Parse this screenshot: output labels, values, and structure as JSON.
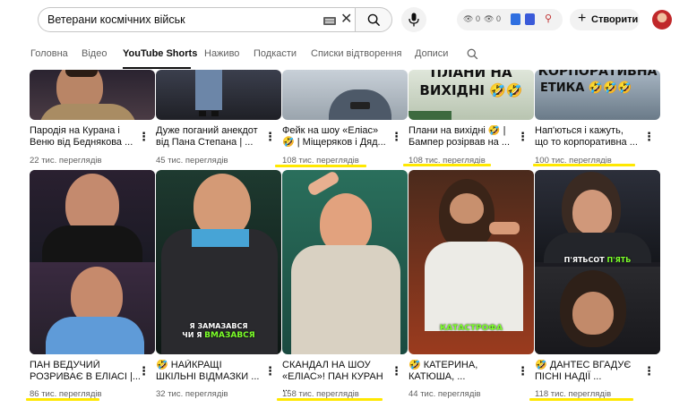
{
  "search": {
    "value": "Ветерани космічних військ"
  },
  "header": {
    "ext": {
      "count_a": "0",
      "count_b": "0"
    },
    "create_label": "Створити"
  },
  "tabs": [
    {
      "label": "Головна"
    },
    {
      "label": "Відео"
    },
    {
      "label": "YouTube Shorts"
    },
    {
      "label": "Наживо"
    },
    {
      "label": "Подкасти"
    },
    {
      "label": "Списки відтворення"
    },
    {
      "label": "Дописи"
    }
  ],
  "row1": [
    {
      "title_line1": "Пародія на Курана і",
      "title_line2": "Веню від Беднякова ...",
      "views": "22 тис. переглядів"
    },
    {
      "title_line1": "Дуже поганий анекдот",
      "title_line2": "від Пана Степана | ...",
      "views": "45 тис. переглядів"
    },
    {
      "title_line1": "Фейк на шоу «Еліас»",
      "title_line2": "🤣 | Міщеряков і Дяд...",
      "views": "108 тис. переглядів",
      "thumb_text": ""
    },
    {
      "title_line1": "Плани на вихідні 🤣 |",
      "title_line2": "Бампер розірвав на ...",
      "views": "108 тис. переглядів",
      "thumb_text_1": "ПЛАНИ НА",
      "thumb_text_2": "ВИХІДНІ 🤣🤣"
    },
    {
      "title_line1": "Нап'ються і кажуть,",
      "title_line2": "що то корпоративна ...",
      "views": "100 тис. переглядів",
      "thumb_text_1": "КОРПОРАТИВНА",
      "thumb_text_2": "ЕТИКА 🤣🤣🤣"
    }
  ],
  "row2": [
    {
      "title_line1": "ПАН ВЕДУЧИЙ",
      "title_line2": "РОЗРИВАЄ В ЕЛІАСІ |...",
      "views": "86 тис. переглядів"
    },
    {
      "title_line1": "🤣 НАЙКРАЩІ",
      "title_line2": "ШКІЛЬНІ ВІДМАЗКИ ...",
      "views": "32 тис. переглядів",
      "caption_1": "Я ЗАМАЗАВСЯ",
      "caption_2a": "ЧИ Я ",
      "caption_2b": "ВМАЗАВСЯ"
    },
    {
      "title_line1": "СКАНДАЛ НА ШОУ",
      "title_line2": "«ЕЛІАС»! ПАН КУРАН ...",
      "views": "158 тис. переглядів"
    },
    {
      "title_line1": "🤣 КАТЕРИНА,",
      "title_line2": "КАТЮША, ...",
      "views": "44 тис. переглядів",
      "caption": "КАТАСТРОФА"
    },
    {
      "title_line1": "🤣 ДАНТЕС ВГАДУЄ",
      "title_line2": "ПІСНІ НАДІЇ ...",
      "views": "118 тис. переглядів",
      "caption_a": "П'ЯТЬСОТ ",
      "caption_b": "П'ЯТЬ"
    }
  ],
  "colors": {
    "highlight": "#ffe800",
    "accent_green": "#7cff2a",
    "text_secondary": "#606060"
  },
  "icons": [
    "keyboard-icon",
    "clear-icon",
    "search-icon",
    "mic-icon",
    "eye-icon",
    "extension-icon",
    "plus-icon",
    "more-vert-icon"
  ]
}
